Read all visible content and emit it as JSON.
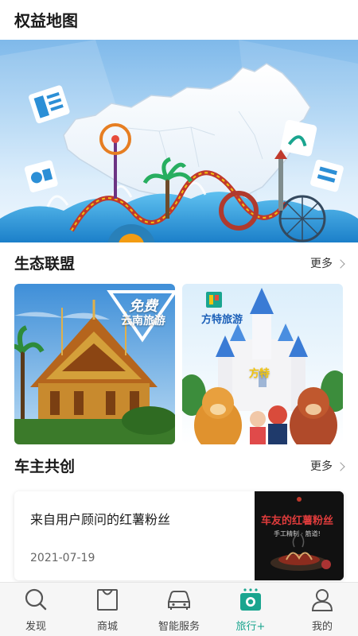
{
  "header": {
    "title": "权益地图"
  },
  "sections": {
    "ecosystem": {
      "title": "生态联盟",
      "more_label": "更多"
    },
    "cocreate": {
      "title": "车主共创",
      "more_label": "更多"
    }
  },
  "cards": {
    "yunnan": {
      "badge_line1": "免费",
      "badge_line2": "云南旅游"
    },
    "fangte": {
      "brand": "方特旅游",
      "sign": "方特"
    }
  },
  "news": {
    "title": "来自用户顾问的红薯粉丝",
    "date": "2021-07-19",
    "thumb_title": "车友的红薯粉丝",
    "thumb_subtitle": "手工精制 · 筋道!"
  },
  "tabbar": {
    "items": [
      {
        "label": "发现",
        "icon": "search-icon"
      },
      {
        "label": "商城",
        "icon": "shopping-bag-icon"
      },
      {
        "label": "智能服务",
        "icon": "car-icon"
      },
      {
        "label": "旅行+",
        "icon": "camera-icon"
      },
      {
        "label": "我的",
        "icon": "user-icon"
      }
    ],
    "active_color": "#1aa58f"
  }
}
